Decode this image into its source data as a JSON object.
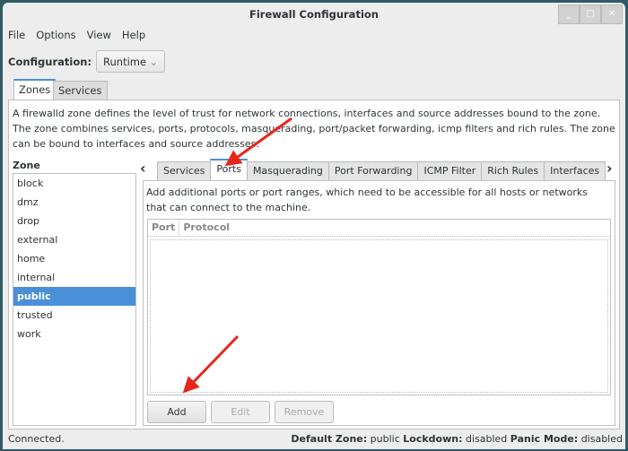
{
  "window": {
    "title": "Firewall Configuration",
    "controls": [
      "minimize",
      "maximize",
      "close"
    ]
  },
  "menu": [
    "File",
    "Options",
    "View",
    "Help"
  ],
  "configuration": {
    "label": "Configuration:",
    "value": "Runtime"
  },
  "top_tabs": [
    {
      "label": "Zones",
      "active": true
    },
    {
      "label": "Services",
      "active": false
    }
  ],
  "zones_description": "A firewalld zone defines the level of trust for network connections, interfaces and source addresses bound to the zone. The zone combines services, ports, protocols, masquerading, port/packet forwarding, icmp filters and rich rules. The zone can be bound to interfaces and source addresses.",
  "zone_label": "Zone",
  "zones": [
    "block",
    "dmz",
    "drop",
    "external",
    "home",
    "internal",
    "public",
    "trusted",
    "work"
  ],
  "selected_zone": "public",
  "inner_tabs": [
    "Services",
    "Ports",
    "Masquerading",
    "Port Forwarding",
    "ICMP Filter",
    "Rich Rules",
    "Interfaces"
  ],
  "active_inner_tab": "Ports",
  "ports": {
    "description": "Add additional ports or port ranges, which need to be accessible for all hosts or networks that can connect to the machine.",
    "columns": [
      "Port",
      "Protocol"
    ],
    "rows": [],
    "buttons": {
      "add": "Add",
      "edit": "Edit",
      "remove": "Remove"
    }
  },
  "status": {
    "text": "Connected.",
    "default_zone_label": "Default Zone:",
    "default_zone": "public",
    "lockdown_label": "Lockdown:",
    "lockdown": "disabled",
    "panic_label": "Panic Mode:",
    "panic": "disabled"
  },
  "colors": {
    "selection": "#4a90d9",
    "annotation_arrow": "#e8261c"
  }
}
